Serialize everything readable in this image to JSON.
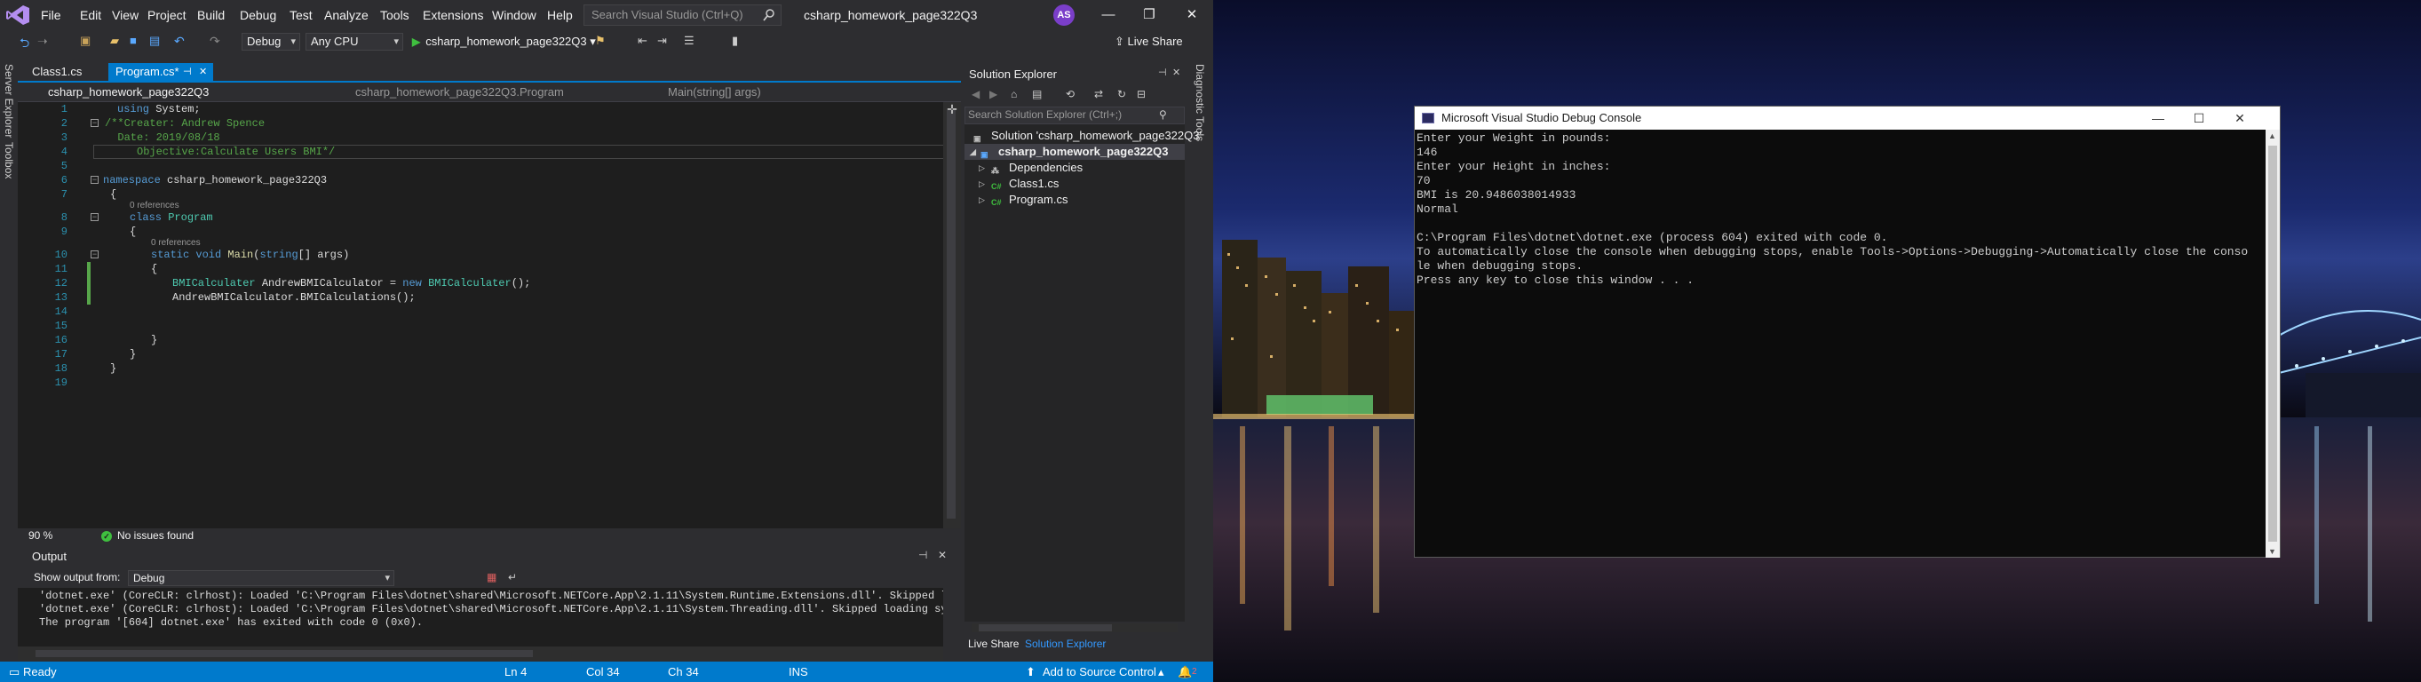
{
  "vs": {
    "menu": [
      "File",
      "Edit",
      "View",
      "Project",
      "Build",
      "Debug",
      "Test",
      "Analyze",
      "Tools",
      "Extensions",
      "Window",
      "Help"
    ],
    "search_placeholder": "Search Visual Studio (Ctrl+Q)",
    "project_title": "csharp_homework_page322Q3",
    "avatar_initials": "AS",
    "window_controls": {
      "minimize": "—",
      "restore": "❐",
      "close": "✕"
    },
    "toolbar": {
      "config": "Debug",
      "platform": "Any CPU",
      "run_target": "csharp_homework_page322Q3",
      "live_share": "Live Share"
    },
    "left_strip": [
      "Server Explorer",
      "Toolbox"
    ],
    "right_strip": [
      "Diagnostic Tools"
    ],
    "tabs": [
      {
        "label": "Class1.cs",
        "active": false
      },
      {
        "label": "Program.cs*",
        "active": true
      }
    ],
    "navbar": {
      "project": "csharp_homework_page322Q3",
      "class": "csharp_homework_page322Q3.Program",
      "member": "Main(string[] args)"
    },
    "code_lines": [
      "1",
      "2",
      "3",
      "4",
      "5",
      "6",
      "7",
      "8",
      "9",
      "10",
      "11",
      "12",
      "13",
      "14",
      "15",
      "16",
      "17",
      "18",
      "19"
    ],
    "code": {
      "l1_kw": "using",
      "l1_rest": " System;",
      "l2": "/**Creater: Andrew Spence",
      "l3": "  Date: 2019/08/18",
      "l4": "     Objective:Calculate Users BMI*/",
      "l6_kw": "namespace",
      "l6_rest": " csharp_homework_page322Q3",
      "l7": "{",
      "refs_class": "0 references",
      "l8_kw": "class",
      "l8_ty": "Program",
      "l9": "{",
      "refs_main": "0 references",
      "l10_kw": "static void",
      "l10_fn": "Main",
      "l10_open": "(",
      "l10_kw2": "string",
      "l10_rest": "[] args)",
      "l11": "{",
      "l12_ty": "BMICalculater",
      "l12_mid": " AndrewBMICalculator = ",
      "l12_kw": "new",
      "l12_ty2": "BMICalculater",
      "l12_end": "();",
      "l13": "AndrewBMICalculator.BMICalculations();",
      "l16": "}",
      "l17": "}",
      "l18": "}"
    },
    "editor_footer": {
      "zoom": "90 %",
      "issues": "No issues found"
    },
    "output": {
      "title": "Output",
      "show_from_label": "Show output from:",
      "source": "Debug",
      "lines": [
        "'dotnet.exe' (CoreCLR: clrhost): Loaded 'C:\\Program Files\\dotnet\\shared\\Microsoft.NETCore.App\\2.1.11\\System.Runtime.Extensions.dll'. Skipped load",
        "'dotnet.exe' (CoreCLR: clrhost): Loaded 'C:\\Program Files\\dotnet\\shared\\Microsoft.NETCore.App\\2.1.11\\System.Threading.dll'. Skipped loading symbo",
        "The program '[604] dotnet.exe' has exited with code 0 (0x0)."
      ]
    },
    "solution_explorer": {
      "title": "Solution Explorer",
      "search_placeholder": "Search Solution Explorer (Ctrl+;)",
      "solution": "Solution 'csharp_homework_page322Q3'",
      "project": "csharp_homework_page322Q3",
      "items": [
        "Dependencies",
        "Class1.cs",
        "Program.cs"
      ],
      "bottom_tabs": [
        "Live Share",
        "Solution Explorer"
      ]
    },
    "status": {
      "ready": "Ready",
      "ln": "Ln 4",
      "col": "Col 34",
      "ch": "Ch 34",
      "ins": "INS",
      "source_control": "Add to Source Control",
      "notifications": "2"
    },
    "colors": {
      "accent": "#007acc",
      "editor_bg": "#1e1e1e",
      "chrome_bg": "#2d2d30"
    }
  },
  "console": {
    "title": "Microsoft Visual Studio Debug Console",
    "controls": {
      "minimize": "—",
      "maximize": "☐",
      "close": "✕"
    },
    "lines": [
      "Enter your Weight in pounds:",
      "146",
      "Enter your Height in inches:",
      "70",
      "BMI is 20.9486038014933",
      "Normal",
      "",
      "C:\\Program Files\\dotnet\\dotnet.exe (process 604) exited with code 0.",
      "To automatically close the console when debugging stops, enable Tools->Options->Debugging->Automatically close the conso",
      "le when debugging stops.",
      "Press any key to close this window . . ."
    ]
  }
}
